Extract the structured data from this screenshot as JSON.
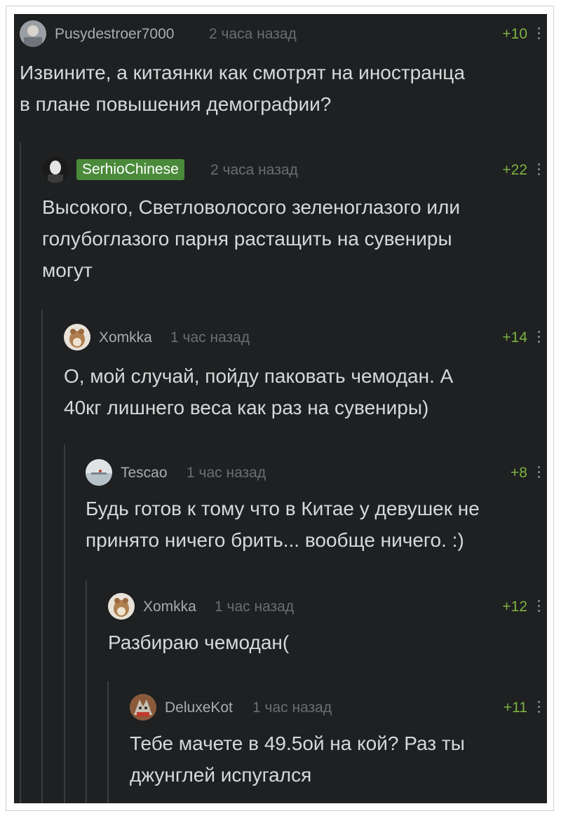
{
  "comments": [
    {
      "username": "Pusydestroer7000",
      "time": "2 часа назад",
      "rating": "+10",
      "avatar": "user-avatar-photo",
      "lines": [
        "Извините, а китаянки как смотрят на иностранца",
        "в плане повышения демографии?"
      ]
    },
    {
      "username": "SerhioChinese",
      "time": "2 часа назад",
      "rating": "+22",
      "avatar": "user-avatar-dark-portrait",
      "lines": [
        "Высокого, Светловолосого зеленоглазого или",
        "голубоглазого парня растащить на сувениры",
        "могут"
      ]
    },
    {
      "username": "Xomkka",
      "time": "1 час назад",
      "rating": "+14",
      "avatar": "hamster-avatar",
      "lines": [
        "О, мой случай, пойду паковать чемодан. А",
        "40кг лишнего веса как раз на сувениры)"
      ]
    },
    {
      "username": "Tescao",
      "time": "1 час назад",
      "rating": "+8",
      "avatar": "landscape-avatar",
      "lines": [
        "Будь готов к тому что в Китае у девушек не",
        "принято ничего брить... вообще ничего. :)"
      ]
    },
    {
      "username": "Xomkka",
      "time": "1 час назад",
      "rating": "+12",
      "avatar": "hamster-avatar",
      "lines": [
        "Разбираю чемодан("
      ]
    },
    {
      "username": "DeluxeKot",
      "time": "1 час назад",
      "rating": "+11",
      "avatar": "cat-avatar",
      "lines": [
        "Тебе мачете в 49.5ой на кой? Раз ты",
        "джунглей испугался"
      ]
    }
  ],
  "colors": {
    "background": "#1e2021",
    "text": "#d6d8da",
    "username": "#a8acb0",
    "time": "#6a6e72",
    "rating": "#7cb342",
    "author_badge": "#4a8a3a"
  }
}
